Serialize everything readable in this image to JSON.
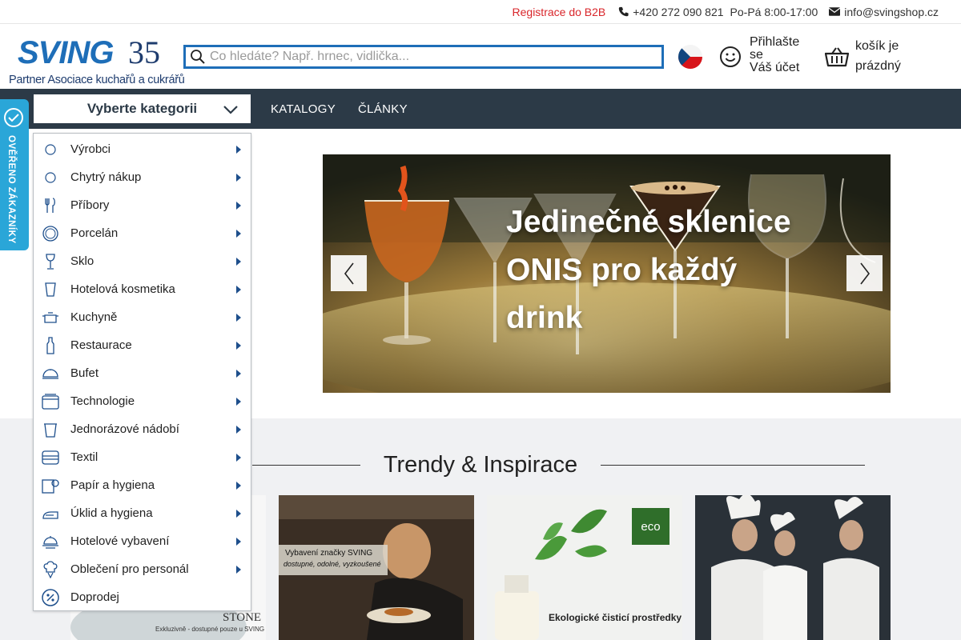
{
  "topbar": {
    "b2b_link": "Registrace do B2B",
    "phone": "+420 272 090 821",
    "hours": "Po-Pá 8:00-17:00",
    "email": "info@svingshop.cz"
  },
  "logo": {
    "wordmark": "SVING",
    "anniversary": "35",
    "tagline": "Partner Asociace kuchařů a cukrářů"
  },
  "search": {
    "placeholder": "Co hledáte? Např. hrnec, vidlička..."
  },
  "language": "CZ",
  "account": {
    "line1": "Přihlašte se",
    "line2": "Váš účet"
  },
  "cart": {
    "line1": "košík je",
    "line2": "prázdný"
  },
  "nav": {
    "category_select": "Vyberte kategorii",
    "links": [
      "KATALOGY",
      "ČLÁNKY"
    ]
  },
  "badge": {
    "text": "OVĚŘENO ZÁKAZNÍKY"
  },
  "categories": [
    {
      "label": "Výrobci",
      "icon": "circle-outline-icon",
      "submenu": true
    },
    {
      "label": "Chytrý nákup",
      "icon": "circle-outline-icon",
      "submenu": true
    },
    {
      "label": "Příbory",
      "icon": "cutlery-icon",
      "submenu": true
    },
    {
      "label": "Porcelán",
      "icon": "plate-icon",
      "submenu": true
    },
    {
      "label": "Sklo",
      "icon": "wine-glass-icon",
      "submenu": true
    },
    {
      "label": "Hotelová kosmetika",
      "icon": "cup-icon",
      "submenu": true
    },
    {
      "label": "Kuchyně",
      "icon": "pot-icon",
      "submenu": true
    },
    {
      "label": "Restaurace",
      "icon": "bottle-icon",
      "submenu": true
    },
    {
      "label": "Bufet",
      "icon": "cloche-icon",
      "submenu": true
    },
    {
      "label": "Technologie",
      "icon": "appliance-icon",
      "submenu": true
    },
    {
      "label": "Jednorázové nádobí",
      "icon": "disposable-cup-icon",
      "submenu": true
    },
    {
      "label": "Textil",
      "icon": "towel-icon",
      "submenu": true
    },
    {
      "label": "Papír a hygiena",
      "icon": "paper-roll-icon",
      "submenu": true
    },
    {
      "label": "Úklid a hygiena",
      "icon": "cleaning-icon",
      "submenu": true
    },
    {
      "label": "Hotelové vybavení",
      "icon": "bell-icon",
      "submenu": true
    },
    {
      "label": "Oblečení pro personál",
      "icon": "chef-hat-icon",
      "submenu": true
    },
    {
      "label": "Doprodej",
      "icon": "percent-icon",
      "submenu": false
    }
  ],
  "slider": {
    "headline": "Jedinečné sklenice ONIS pro každý drink"
  },
  "trends": {
    "title": "Trendy & Inspirace",
    "cards": [
      {
        "caption_main": "STONE",
        "caption_sub": "Exkluzivně - dostupné pouze u SVING"
      },
      {
        "caption_main": "Vybavení značky SVING",
        "caption_sub": "dostupné, odolné, vyzkoušené"
      },
      {
        "caption_main": "Ekologické čisticí prostředky",
        "caption_sub": "eco"
      },
      {
        "caption_main": "",
        "caption_sub": ""
      }
    ]
  },
  "colors": {
    "brand_blue": "#1e6eb8",
    "nav_dark": "#2c3a47",
    "b2b_red": "#d9262b",
    "badge_blue": "#2aa6d8",
    "section_gray": "#f0f1f3"
  }
}
